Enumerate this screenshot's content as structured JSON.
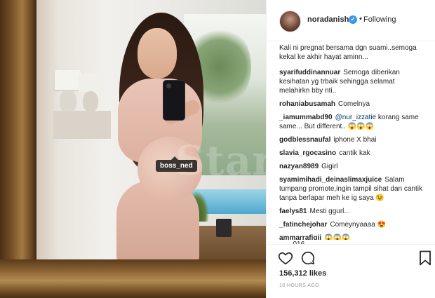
{
  "post": {
    "username": "noradanish",
    "follow_status": "Following",
    "dot": "•",
    "verified_mark": "✔",
    "caption": "Kali ni pregnat bersama dgn suami..semoga kekal ke akhir hayat aminn...",
    "comments": [
      {
        "user": "syarifuddinannuar",
        "text": "Semoga diberikan kesihatan yg trbaik sehingga selamat melahirkn bby nti.."
      },
      {
        "user": "rohaniabusamah",
        "text": "Comelnya"
      },
      {
        "user": "_iamummabd90",
        "mention": "@nur_izzatie",
        "text": "korang same same... But different.. 😱😱😱"
      },
      {
        "user": "godblessnaufal",
        "text": "iphone X bhai"
      },
      {
        "user": "slavia_rgocasino",
        "text": "cantik kak"
      },
      {
        "user": "nazyan8989",
        "text": "Gigirl"
      },
      {
        "user": "syamimihadi_deinaslimaxjuice",
        "text": "Salam tumpang promote,ingin tampil sihat dan cantik tanpa berlapar meh ke ig saya 😉"
      },
      {
        "user": "faelys81",
        "text": "Mesti ggurl..."
      },
      {
        "user": "_fatinchejohar",
        "text": "Comeynyaaaa 😍"
      },
      {
        "user": "ammarrafiqii",
        "text": "😱😱😱"
      }
    ],
    "partial_comment": "___ 016 ____",
    "likes": "156,312 likes",
    "time": "18 HOURS AGO"
  },
  "photo": {
    "tag_label": "boss_ned",
    "watermark": "Star"
  },
  "colors": {
    "verified": "#3897f0",
    "mention": "#003569",
    "text": "#262626",
    "muted": "#999999"
  },
  "icons": {
    "like": "heart-icon",
    "comment": "comment-bubble-icon",
    "save": "bookmark-icon",
    "verified": "verified-badge-icon"
  }
}
